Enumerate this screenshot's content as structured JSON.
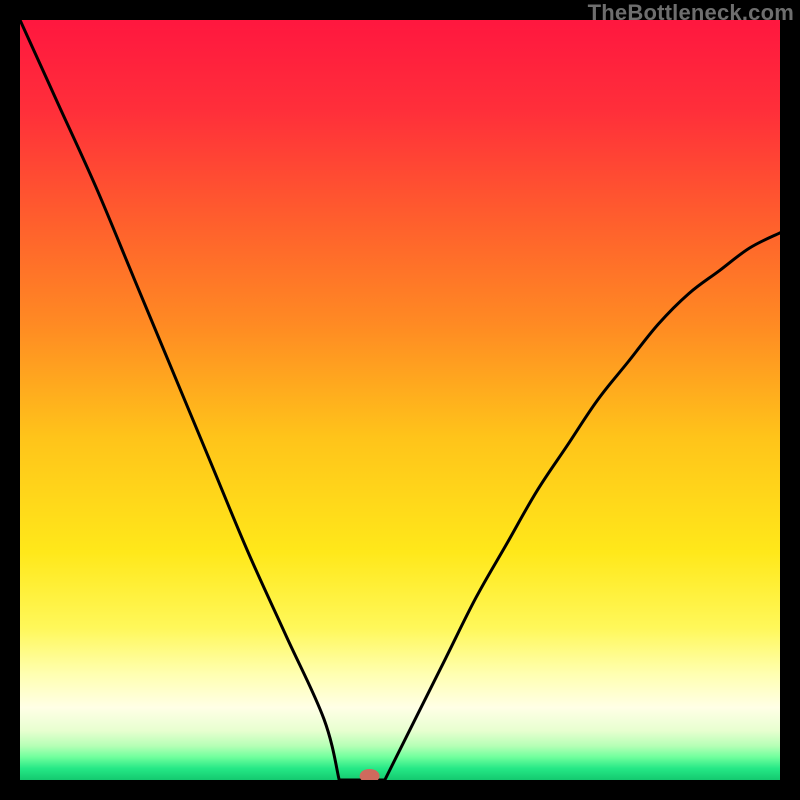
{
  "watermark": "TheBottleneck.com",
  "marker": {
    "x_percent": 46,
    "color": "#cf6a5d",
    "rx": 10,
    "ry": 7
  },
  "gradient_stops": [
    {
      "offset": 0.0,
      "color": "#ff173f"
    },
    {
      "offset": 0.12,
      "color": "#ff2f3a"
    },
    {
      "offset": 0.25,
      "color": "#ff5a2e"
    },
    {
      "offset": 0.4,
      "color": "#ff8a23"
    },
    {
      "offset": 0.55,
      "color": "#ffc41a"
    },
    {
      "offset": 0.7,
      "color": "#ffe81a"
    },
    {
      "offset": 0.8,
      "color": "#fff85a"
    },
    {
      "offset": 0.86,
      "color": "#ffffb0"
    },
    {
      "offset": 0.905,
      "color": "#ffffe6"
    },
    {
      "offset": 0.935,
      "color": "#e8ffd0"
    },
    {
      "offset": 0.955,
      "color": "#b6ffb6"
    },
    {
      "offset": 0.97,
      "color": "#6fff9d"
    },
    {
      "offset": 0.985,
      "color": "#25e886"
    },
    {
      "offset": 1.0,
      "color": "#14c96f"
    }
  ],
  "chart_data": {
    "type": "line",
    "title": "",
    "xlabel": "",
    "ylabel": "",
    "xlim": [
      0,
      100
    ],
    "ylim": [
      0,
      100
    ],
    "flat_region": {
      "x_start": 42,
      "x_end": 48,
      "y": 0
    },
    "series": [
      {
        "name": "left-branch",
        "x": [
          0,
          5,
          10,
          15,
          20,
          25,
          30,
          35,
          40,
          42
        ],
        "y": [
          100,
          89,
          78,
          66,
          54,
          42,
          30,
          19,
          8,
          0
        ]
      },
      {
        "name": "right-branch",
        "x": [
          48,
          52,
          56,
          60,
          64,
          68,
          72,
          76,
          80,
          84,
          88,
          92,
          96,
          100
        ],
        "y": [
          0,
          8,
          16,
          24,
          31,
          38,
          44,
          50,
          55,
          60,
          64,
          67,
          70,
          72
        ]
      }
    ]
  }
}
